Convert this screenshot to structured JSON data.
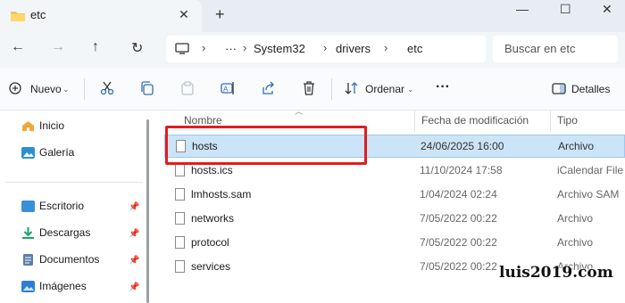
{
  "tab": {
    "title": "etc",
    "close_glyph": "✕",
    "add_glyph": "+"
  },
  "window": {
    "minimize_glyph": "—",
    "maximize_glyph": "☐",
    "close_glyph": "✕"
  },
  "nav": {
    "back_glyph": "←",
    "forward_glyph": "→",
    "up_glyph": "↑",
    "refresh_glyph": "↻",
    "breadcrumb": [
      "System32",
      "drivers",
      "etc"
    ],
    "overflow_glyph": "···",
    "separator_glyph": "›",
    "search_placeholder": "Buscar en etc"
  },
  "commands": {
    "new_label": "Nuevo",
    "sort_label": "Ordenar",
    "more_glyph": "···",
    "details_label": "Detalles",
    "icons": [
      "cut-icon",
      "copy-icon",
      "paste-icon",
      "rename-icon",
      "share-icon",
      "delete-icon"
    ]
  },
  "sidebar": {
    "items": [
      {
        "label": "Inicio",
        "icon": "home-icon",
        "pinned": false
      },
      {
        "label": "Galería",
        "icon": "gallery-icon",
        "pinned": false
      },
      {
        "label": "Escritorio",
        "icon": "desktop-icon",
        "pinned": true
      },
      {
        "label": "Descargas",
        "icon": "downloads-icon",
        "pinned": true
      },
      {
        "label": "Documentos",
        "icon": "documents-icon",
        "pinned": true
      },
      {
        "label": "Imágenes",
        "icon": "pictures-icon",
        "pinned": true
      }
    ],
    "pin_glyph": "📌"
  },
  "columns": {
    "name": "Nombre",
    "date": "Fecha de modificación",
    "type": "Tipo"
  },
  "files": [
    {
      "name": "hosts",
      "date": "24/06/2025 16:00",
      "type": "Archivo",
      "selected": true
    },
    {
      "name": "hosts.ics",
      "date": "11/10/2024 17:58",
      "type": "iCalendar File",
      "selected": false
    },
    {
      "name": "lmhosts.sam",
      "date": "1/04/2024 02:24",
      "type": "Archivo SAM",
      "selected": false
    },
    {
      "name": "networks",
      "date": "7/05/2022 00:22",
      "type": "Archivo",
      "selected": false
    },
    {
      "name": "protocol",
      "date": "7/05/2022 00:22",
      "type": "Archivo",
      "selected": false
    },
    {
      "name": "services",
      "date": "7/05/2022 00:22",
      "type": "Archivo",
      "selected": false
    }
  ],
  "watermark": "luis2019.com",
  "colors": {
    "selection": "#cce4f7",
    "highlight": "#e01e1e",
    "accent": "#2f6fb3"
  }
}
